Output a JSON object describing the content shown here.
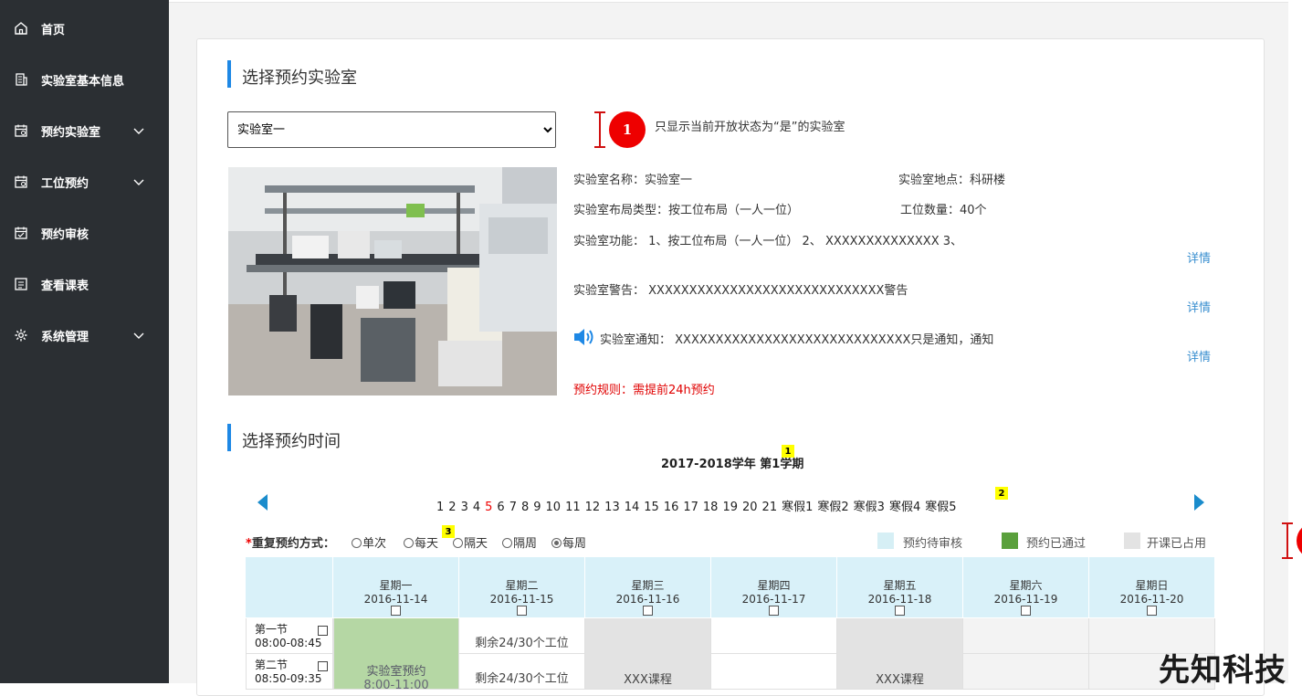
{
  "sidebar": {
    "items": [
      {
        "label": "首页",
        "icon": "home-icon"
      },
      {
        "label": "实验室基本信息",
        "icon": "building-icon"
      },
      {
        "label": "预约实验室",
        "icon": "calendar-icon"
      },
      {
        "label": "工位预约",
        "icon": "calendar-icon"
      },
      {
        "label": "预约审核",
        "icon": "calendar-check-icon"
      },
      {
        "label": "查看课表",
        "icon": "list-icon"
      },
      {
        "label": "系统管理",
        "icon": "gear-icon"
      }
    ]
  },
  "lab_section": {
    "title": "选择预约实验室",
    "select_value": "实验室一",
    "annotation_number": "1",
    "annotation_note": "只显示当前开放状态为“是”的实验室",
    "name": "实验室名称：实验室一",
    "location": "实验室地点：科研楼",
    "layout_type": "实验室布局类型：按工位布局（一人一位）",
    "station_count": "工位数量：40个",
    "function": "实验室功能：  1、按工位布局（一人一位） 2、  XXXXXXXXXXXXXX  3、",
    "warning": "实验室警告：  XXXXXXXXXXXXXXXXXXXXXXXXXXXXX警告",
    "notice": "实验室通知：  XXXXXXXXXXXXXXXXXXXXXXXXXXXXX只是通知，通知",
    "detail_label": "详情",
    "rule": "预约规则：需提前24h预约"
  },
  "time_section": {
    "title": "选择预约时间",
    "semester": "2017-2018学年 第1学期",
    "badges": [
      "1",
      "2",
      "3"
    ],
    "current_week": "5",
    "weeks": [
      "1",
      "2",
      "3",
      "4",
      "5",
      "6",
      "7",
      "8",
      "9",
      "10",
      "11",
      "12",
      "13",
      "14",
      "15",
      "16",
      "17",
      "18",
      "19",
      "20",
      "21",
      "寒假1",
      "寒假2",
      "寒假3",
      "寒假4",
      "寒假5"
    ],
    "repeat_label": "重复预约方式：",
    "repeat_required": "*",
    "repeat_options": [
      "单次",
      "每天",
      "隔天",
      "隔周",
      "每周"
    ],
    "repeat_selected": "每周",
    "legend": [
      {
        "label": "预约待审核",
        "color": "#d6eff5"
      },
      {
        "label": "预约已通过",
        "color": "#5aa03c"
      },
      {
        "label": "开课已占用",
        "color": "#e3e3e3"
      }
    ]
  },
  "schedule": {
    "days": [
      {
        "weekday": "星期一",
        "date": "2016-11-14"
      },
      {
        "weekday": "星期二",
        "date": "2016-11-15"
      },
      {
        "weekday": "星期三",
        "date": "2016-11-16"
      },
      {
        "weekday": "星期四",
        "date": "2016-11-17"
      },
      {
        "weekday": "星期五",
        "date": "2016-11-18"
      },
      {
        "weekday": "星期六",
        "date": "2016-11-19"
      },
      {
        "weekday": "星期日",
        "date": "2016-11-20"
      }
    ],
    "slots": [
      {
        "name": "第一节",
        "time": "08:00-08:45"
      },
      {
        "name": "第二节",
        "time": "08:50-09:35"
      }
    ],
    "mon_booking": "实验室预约",
    "mon_booking_time": "8:00-11:00",
    "remaining": "剩余24/30个工位",
    "course": "XXX课程",
    "colors": {
      "approved": "#b5d7a4",
      "occupied": "#e3e3e3",
      "weekend": "#f3f3f3"
    }
  },
  "watermark": "先知科技"
}
